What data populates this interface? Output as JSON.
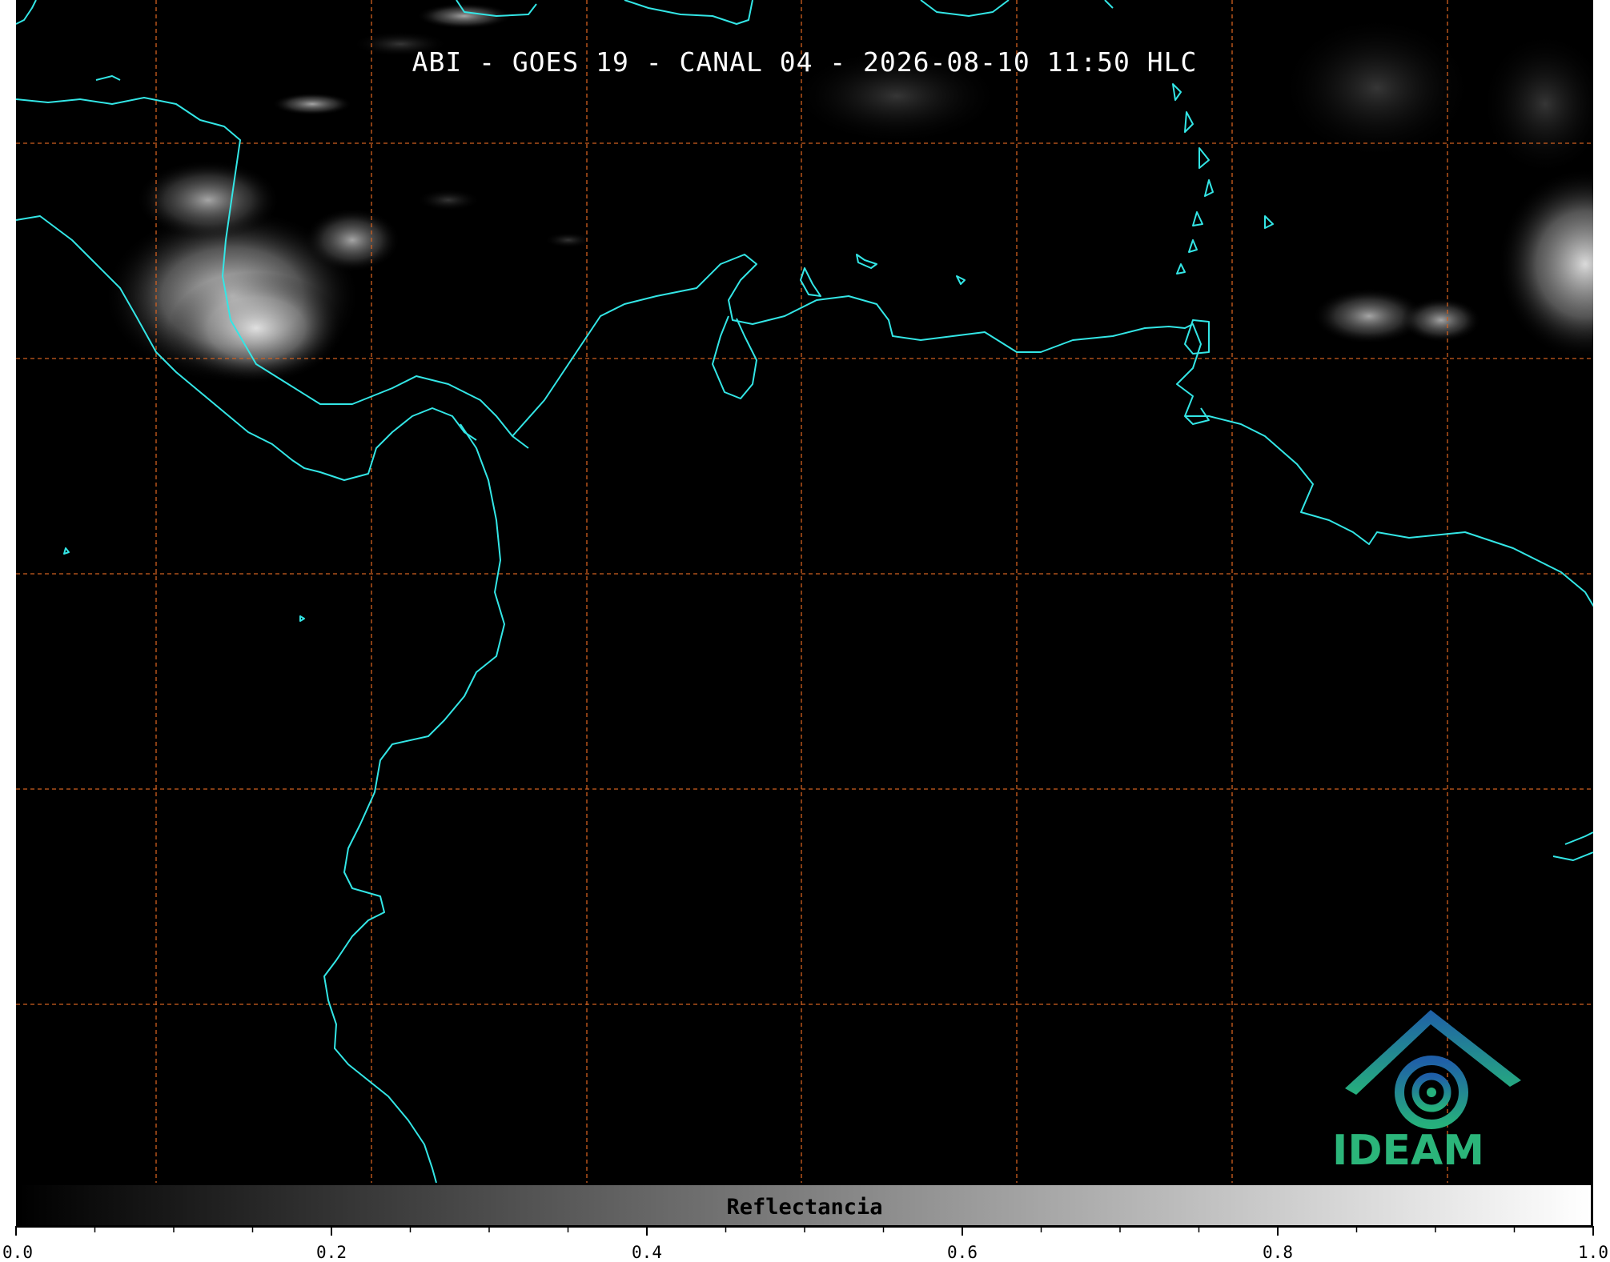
{
  "map": {
    "title": "ABI - GOES 19 - CANAL 04 - 2026-08-10 11:50 HLC",
    "background_color": "#000000",
    "coastline_color": "#33e6e6",
    "gridline_color": "#d06020"
  },
  "logo": {
    "text": "IDEAM",
    "text_color": "#2bb57a",
    "icon": "ideam-mountain-spiral-icon"
  },
  "colorbar": {
    "label": "Reflectancia",
    "min": 0.0,
    "max": 1.0,
    "colormap": [
      "#000000",
      "#ffffff"
    ],
    "major_ticks": [
      "0.0",
      "0.2",
      "0.4",
      "0.6",
      "0.8",
      "1.0"
    ],
    "minor_tick_step": 0.05
  }
}
